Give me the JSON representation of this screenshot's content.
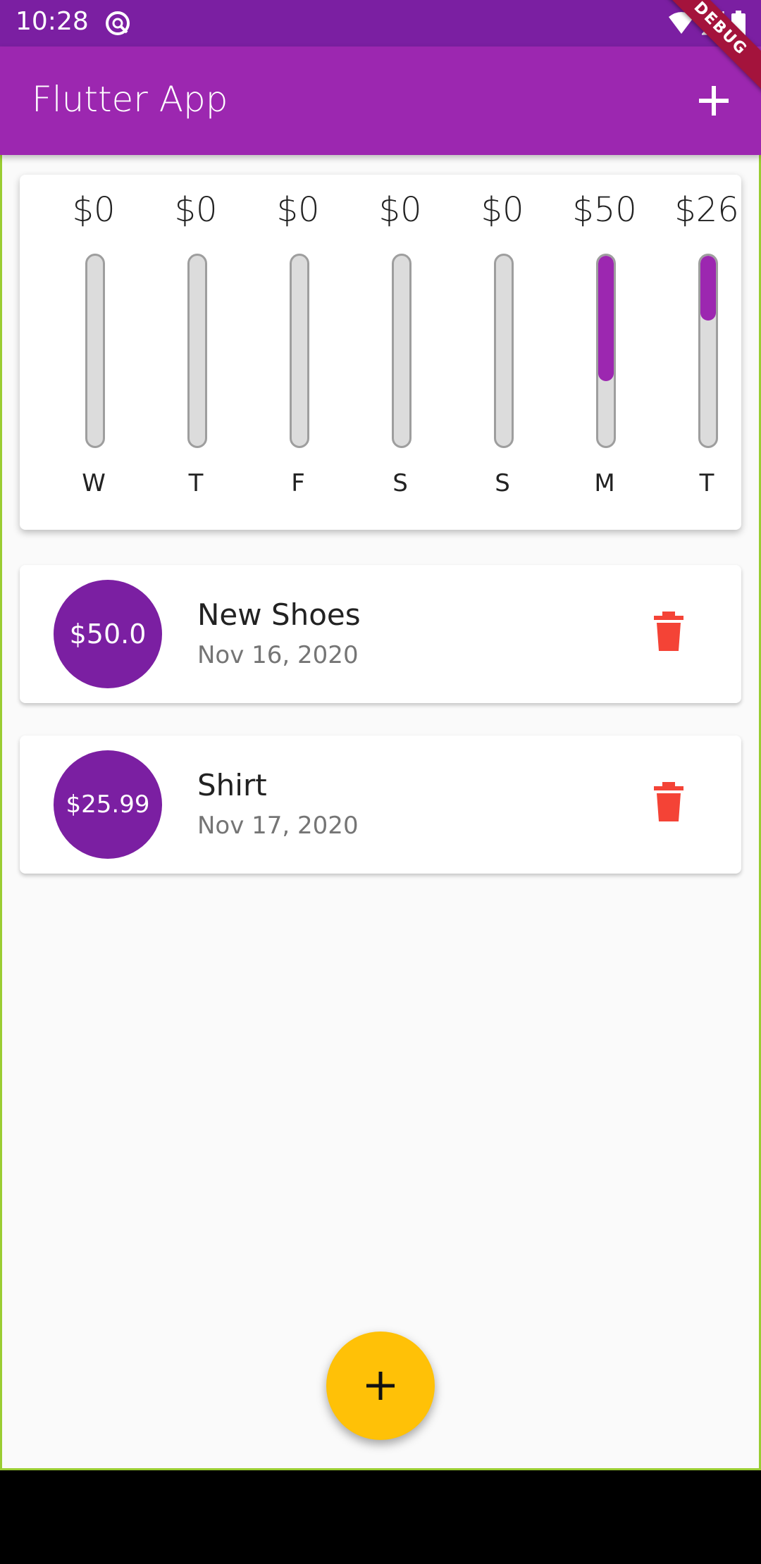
{
  "status_bar": {
    "time": "10:28",
    "icons": [
      "app-notification-icon",
      "wifi-icon",
      "signal-icon",
      "battery-icon"
    ]
  },
  "app_bar": {
    "title": "Flutter App",
    "action_icon": "add-icon",
    "debug_banner": "DEBUG"
  },
  "colors": {
    "primary": "#9c27b0",
    "primary_dark": "#7b1fa2",
    "accent": "#ffc107",
    "delete": "#f44336"
  },
  "chart": {
    "bars": [
      {
        "day": "W",
        "amount": "$0",
        "fraction": 0.0
      },
      {
        "day": "T",
        "amount": "$0",
        "fraction": 0.0
      },
      {
        "day": "F",
        "amount": "$0",
        "fraction": 0.0
      },
      {
        "day": "S",
        "amount": "$0",
        "fraction": 0.0
      },
      {
        "day": "S",
        "amount": "$0",
        "fraction": 0.0
      },
      {
        "day": "M",
        "amount": "$50",
        "fraction": 0.658
      },
      {
        "day": "T",
        "amount": "$26",
        "fraction": 0.342
      }
    ]
  },
  "transactions": [
    {
      "amount": "$50.0",
      "title": "New Shoes",
      "date": "Nov 16, 2020",
      "delete_icon": "trash-icon"
    },
    {
      "amount": "$25.99",
      "title": "Shirt",
      "date": "Nov 17, 2020",
      "delete_icon": "trash-icon"
    }
  ],
  "fab": {
    "icon": "add-icon"
  }
}
